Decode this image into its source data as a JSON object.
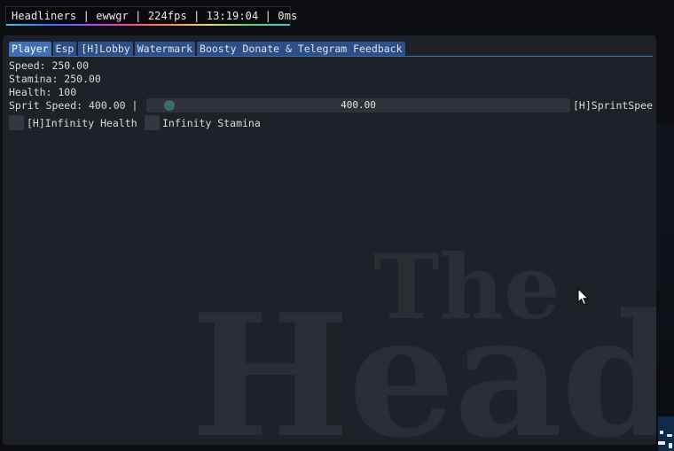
{
  "watermark": {
    "text": "Headliners | ewwgr | 224fps | 13:19:04 | 0ms"
  },
  "tabs": [
    {
      "label": "Player",
      "active": true
    },
    {
      "label": "Esp",
      "active": false
    },
    {
      "label": "[H]Lobby",
      "active": false
    },
    {
      "label": "Watermark",
      "active": false
    },
    {
      "label": "Boosty Donate & Telegram Feedback",
      "active": false
    }
  ],
  "player": {
    "speed": "Speed: 250.00",
    "stamina": "Stamina: 250.00",
    "health": "Health: 100",
    "sprint_label": "Sprit Speed: 400.00 |",
    "sprint_value": "400.00",
    "sprint_slider_fraction": 0.04,
    "sprint_suffix": "[H]SprintSpee",
    "checkboxes": [
      {
        "label": "[H]Infinity Health",
        "checked": false
      },
      {
        "label": "Infinity Stamina",
        "checked": false
      }
    ]
  },
  "background": {
    "logo_line1": "The",
    "logo_line2": "Head"
  },
  "colors": {
    "accent": "#3f6fb4",
    "tab": "#2b4f86",
    "window": "#1e2127",
    "text": "#d7d9de"
  },
  "icons": {
    "cursor": "mouse-pointer-icon"
  }
}
